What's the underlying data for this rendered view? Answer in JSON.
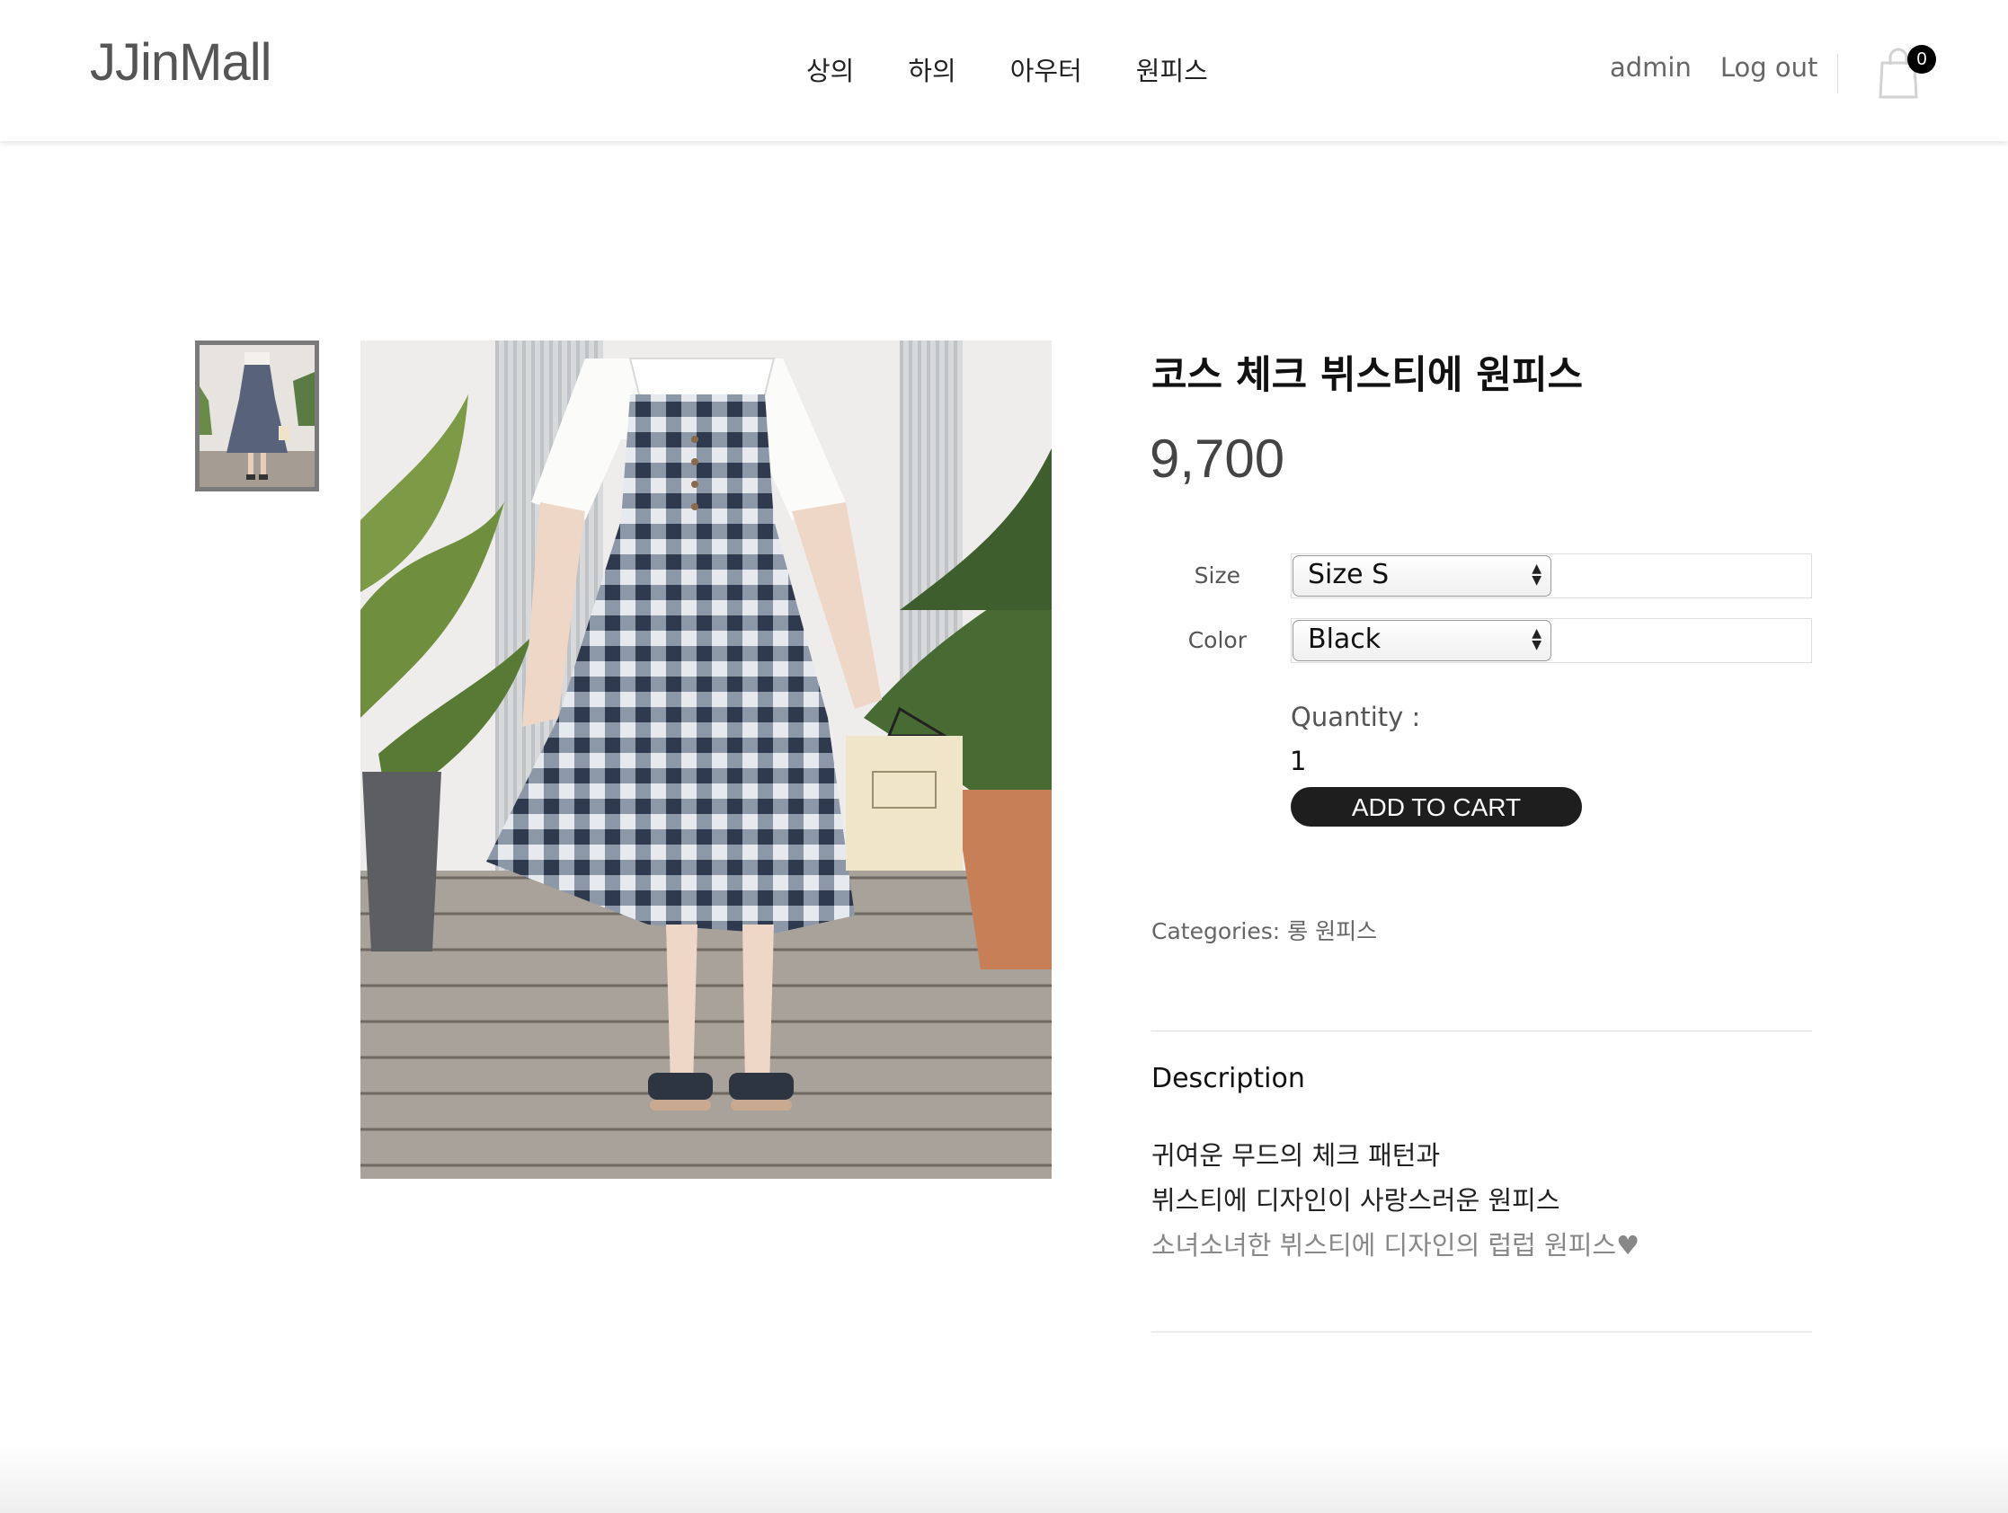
{
  "header": {
    "logo": "JJinMall",
    "nav": [
      "상의",
      "하의",
      "아우터",
      "원피스"
    ],
    "user_links": [
      "admin",
      "Log out"
    ],
    "cart_count": "0",
    "cart_icon": "shopping-bag-icon"
  },
  "product": {
    "title": "코스 체크 뷔스티에 원피스",
    "price": "9,700",
    "options": {
      "size_label": "Size",
      "size_value": "Size S",
      "color_label": "Color",
      "color_value": "Black"
    },
    "quantity_label": "Quantity :",
    "quantity_value": "1",
    "add_to_cart": "ADD TO CART",
    "categories_label": "Categories:",
    "category": "롱 원피스",
    "description_title": "Description",
    "description_lines": [
      "귀여운 무드의 체크 패턴과",
      "뷔스티에 디자인이 사랑스러운 원피스",
      "소녀소녀한 뷔스티에 디자인의 럽럽 원피스♥"
    ]
  },
  "colors": {
    "accent": "#1e1e1e",
    "muted_text": "#666666",
    "description_muted": "#888888"
  }
}
